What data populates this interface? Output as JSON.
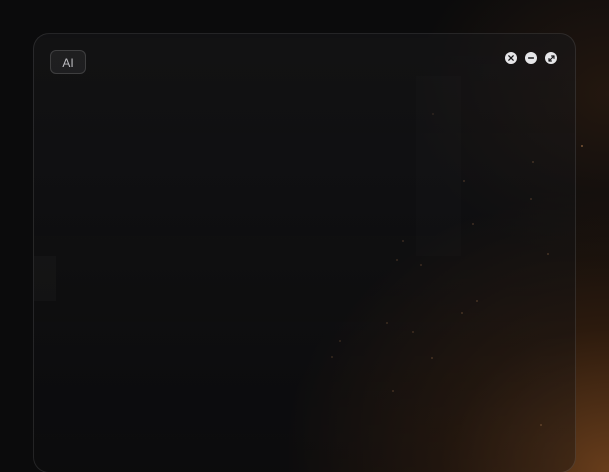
{
  "badge": {
    "label": "AI"
  },
  "window_controls": [
    {
      "name": "close",
      "icon": "close-icon"
    },
    {
      "name": "minimize",
      "icon": "minus-icon"
    },
    {
      "name": "expand",
      "icon": "expand-icon"
    }
  ],
  "colors": {
    "background": "#0b0b0c",
    "glow": "#78461e",
    "control": "#e6e6e8"
  }
}
